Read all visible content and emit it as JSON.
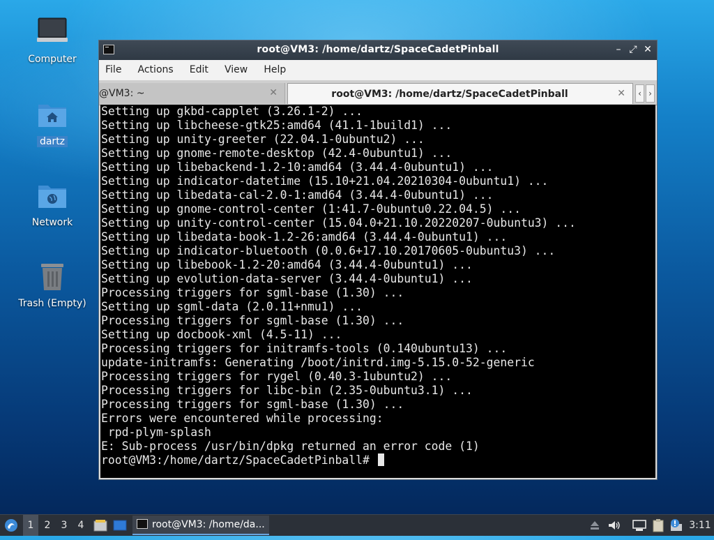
{
  "desktop": {
    "icons": [
      {
        "label": "Computer"
      },
      {
        "label": "dartz"
      },
      {
        "label": "Network"
      },
      {
        "label": "Trash (Empty)"
      }
    ]
  },
  "window": {
    "title": "root@VM3: /home/dartz/SpaceCadetPinball",
    "controls": {
      "minimize": "–",
      "maximize": "⤢",
      "close": "✕"
    },
    "menu": [
      "File",
      "Actions",
      "Edit",
      "View",
      "Help"
    ],
    "tabs": [
      {
        "label": "@VM3: ~"
      },
      {
        "label": "root@VM3: /home/dartz/SpaceCadetPinball"
      }
    ],
    "tab_close": "✕",
    "tab_scroll_left": "‹",
    "tab_scroll_right": "›"
  },
  "terminal": {
    "lines": [
      "Setting up gkbd-capplet (3.26.1-2) ...",
      "Setting up libcheese-gtk25:amd64 (41.1-1build1) ...",
      "Setting up unity-greeter (22.04.1-0ubuntu2) ...",
      "Setting up gnome-remote-desktop (42.4-0ubuntu1) ...",
      "Setting up libebackend-1.2-10:amd64 (3.44.4-0ubuntu1) ...",
      "Setting up indicator-datetime (15.10+21.04.20210304-0ubuntu1) ...",
      "Setting up libedata-cal-2.0-1:amd64 (3.44.4-0ubuntu1) ...",
      "Setting up gnome-control-center (1:41.7-0ubuntu0.22.04.5) ...",
      "Setting up unity-control-center (15.04.0+21.10.20220207-0ubuntu3) ...",
      "Setting up libedata-book-1.2-26:amd64 (3.44.4-0ubuntu1) ...",
      "Setting up indicator-bluetooth (0.0.6+17.10.20170605-0ubuntu3) ...",
      "Setting up libebook-1.2-20:amd64 (3.44.4-0ubuntu1) ...",
      "Setting up evolution-data-server (3.44.4-0ubuntu1) ...",
      "Processing triggers for sgml-base (1.30) ...",
      "Setting up sgml-data (2.0.11+nmu1) ...",
      "Processing triggers for sgml-base (1.30) ...",
      "Setting up docbook-xml (4.5-11) ...",
      "Processing triggers for initramfs-tools (0.140ubuntu13) ...",
      "update-initramfs: Generating /boot/initrd.img-5.15.0-52-generic",
      "Processing triggers for rygel (0.40.3-1ubuntu2) ...",
      "Processing triggers for libc-bin (2.35-0ubuntu3.1) ...",
      "Processing triggers for sgml-base (1.30) ...",
      "Errors were encountered while processing:",
      " rpd-plym-splash",
      "E: Sub-process /usr/bin/dpkg returned an error code (1)"
    ],
    "prompt": "root@VM3:/home/dartz/SpaceCadetPinball#"
  },
  "taskbar": {
    "workspaces": [
      "1",
      "2",
      "3",
      "4"
    ],
    "active_workspace": "1",
    "task_label": "root@VM3: /home/da...",
    "clock": "3:11"
  },
  "colors": {
    "terminal_bg": "#000000",
    "terminal_fg": "#e8e8e8",
    "titlebar": "#2f3944",
    "taskbar": "#2b3038",
    "accent": "#6aa6e0"
  }
}
